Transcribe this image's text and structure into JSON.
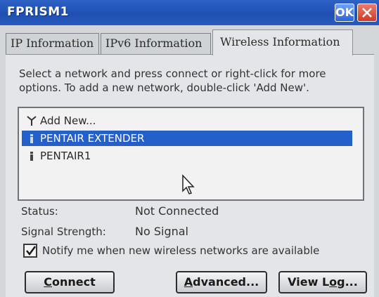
{
  "window": {
    "title": "FPRISM1",
    "ok_label": "OK"
  },
  "tabs": [
    {
      "label": "IP Information"
    },
    {
      "label": "IPv6 Information"
    },
    {
      "label": "Wireless Information",
      "active": true
    }
  ],
  "instructions": "Select a network and press connect or right-click for more options.  To add a new network, double-click 'Add New'.",
  "networks": [
    {
      "label": "Add New...",
      "icon": "antenna-icon"
    },
    {
      "label": "PENTAIR EXTENDER",
      "icon": "signal-icon",
      "selected": true
    },
    {
      "label": "PENTAIR1",
      "icon": "signal-icon"
    }
  ],
  "status": {
    "label": "Status:",
    "value": "Not Connected"
  },
  "signal": {
    "label": "Signal Strength:",
    "value": "No Signal"
  },
  "notify": {
    "label": "Notify me when new wireless networks are available",
    "checked": true
  },
  "buttons": {
    "connect_first": "C",
    "connect_rest": "onnect",
    "advanced_first": "A",
    "advanced_rest": "dvanced...",
    "viewlog_pre": "View L",
    "viewlog_u": "o",
    "viewlog_post": "g..."
  },
  "colors": {
    "titlebar": "#1f4fb2",
    "selection": "#2460c9",
    "close": "#cc3b2b"
  }
}
